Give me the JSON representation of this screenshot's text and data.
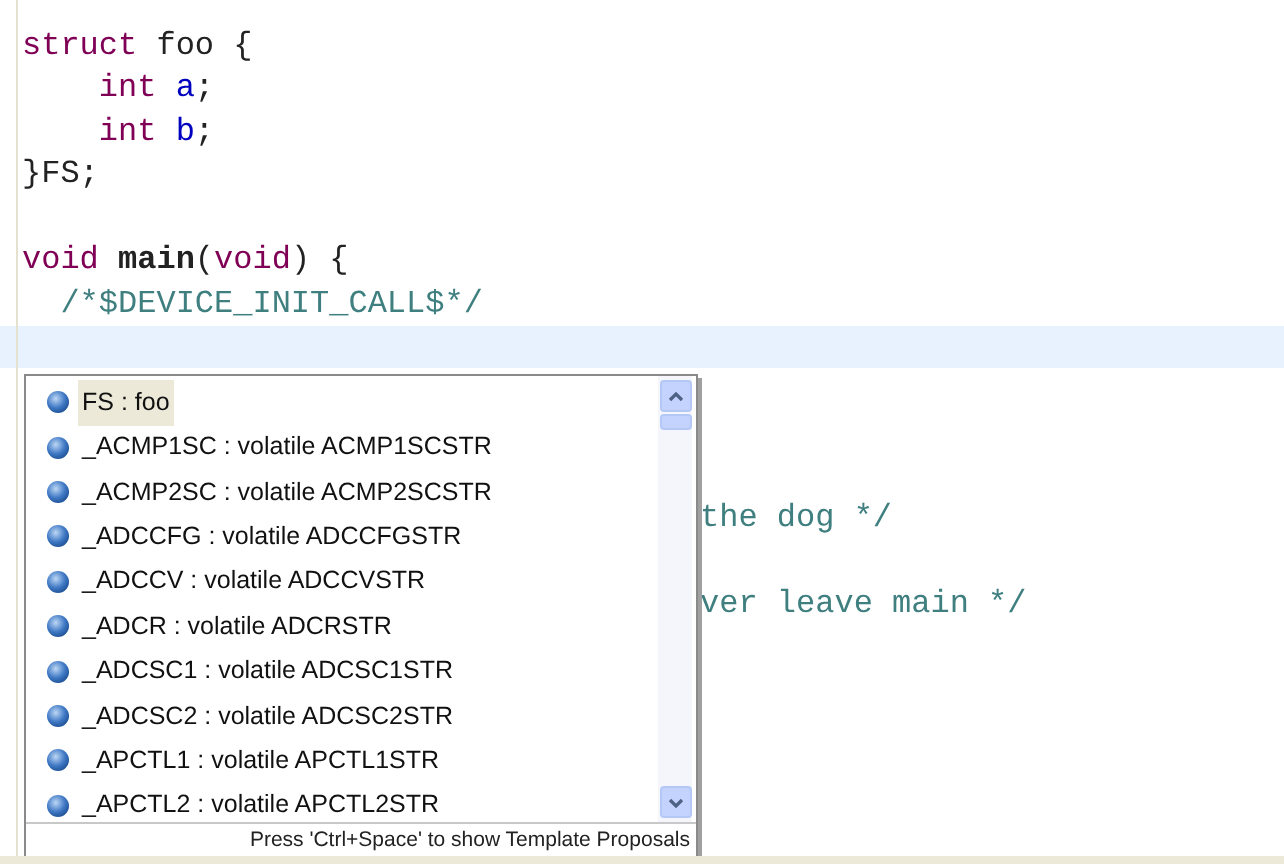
{
  "editor": {
    "lines": [
      {
        "kind": "code",
        "tokens": [
          {
            "kind": "keyword",
            "text": "struct"
          },
          {
            "kind": "plain",
            "text": " foo {"
          }
        ]
      },
      {
        "kind": "code",
        "tokens": [
          {
            "kind": "keyword",
            "text": "    int"
          },
          {
            "kind": "field",
            "text": " a"
          },
          {
            "kind": "plain",
            "text": ";"
          }
        ]
      },
      {
        "kind": "code",
        "tokens": [
          {
            "kind": "keyword",
            "text": "    int"
          },
          {
            "kind": "field",
            "text": " b"
          },
          {
            "kind": "plain",
            "text": ";"
          }
        ]
      },
      {
        "kind": "code",
        "tokens": [
          {
            "kind": "plain",
            "text": "}FS;"
          }
        ]
      },
      {
        "kind": "code"
      },
      {
        "kind": "code",
        "tokens": [
          {
            "kind": "keyword",
            "text": "void"
          },
          {
            "kind": "bold",
            "text": " main"
          },
          {
            "kind": "plain",
            "text": "("
          },
          {
            "kind": "keyword",
            "text": "void"
          },
          {
            "kind": "plain",
            "text": ") {"
          }
        ]
      },
      {
        "kind": "code",
        "tokens": [
          {
            "kind": "comment",
            "text": "  /*$DEVICE_INIT_CALL$*/"
          }
        ]
      },
      {
        "kind": "current"
      },
      {
        "kind": "code"
      },
      {
        "kind": "code"
      },
      {
        "kind": "code"
      },
      {
        "kind": "obscured",
        "tokens": [
          {
            "kind": "comment",
            "text": "the dog */"
          }
        ]
      },
      {
        "kind": "code"
      },
      {
        "kind": "obscured",
        "tokens": [
          {
            "kind": "comment",
            "text": "ver leave main */"
          }
        ]
      }
    ]
  },
  "completion": {
    "items": [
      {
        "label": "FS : foo",
        "selected": true
      },
      {
        "label": "_ACMP1SC : volatile ACMP1SCSTR",
        "selected": false
      },
      {
        "label": "_ACMP2SC : volatile ACMP2SCSTR",
        "selected": false
      },
      {
        "label": "_ADCCFG : volatile ADCCFGSTR",
        "selected": false
      },
      {
        "label": "_ADCCV : volatile ADCCVSTR",
        "selected": false
      },
      {
        "label": "_ADCR : volatile ADCRSTR",
        "selected": false
      },
      {
        "label": "_ADCSC1 : volatile ADCSC1STR",
        "selected": false
      },
      {
        "label": "_ADCSC2 : volatile ADCSC2STR",
        "selected": false
      },
      {
        "label": "_APCTL1 : volatile APCTL1STR",
        "selected": false
      },
      {
        "label": "_APCTL2 : volatile APCTL2STR",
        "selected": false
      }
    ],
    "status": "Press 'Ctrl+Space' to show Template Proposals"
  }
}
